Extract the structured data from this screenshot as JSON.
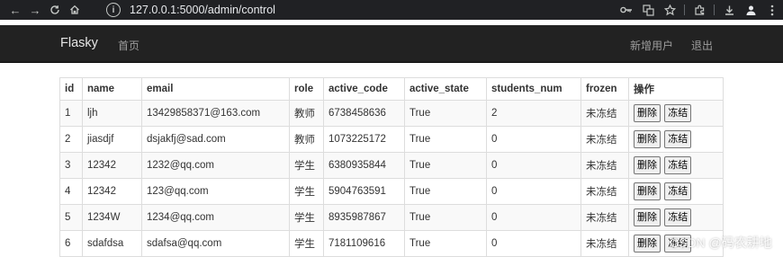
{
  "browser": {
    "url": "127.0.0.1:5000/admin/control",
    "back_glyph": "←",
    "forward_glyph": "→",
    "reload_glyph": "C",
    "home_glyph": "⌂",
    "info_glyph": "i"
  },
  "navbar": {
    "brand": "Flasky",
    "home_label": "首页",
    "add_user_label": "新增用户",
    "logout_label": "退出"
  },
  "table": {
    "headers": [
      "id",
      "name",
      "email",
      "role",
      "active_code",
      "active_state",
      "students_num",
      "frozen",
      "操作"
    ],
    "rows": [
      {
        "id": "1",
        "name": "ljh",
        "email": "13429858371@163.com",
        "role": "教师",
        "active_code": "6738458636",
        "active_state": "True",
        "students_num": "2",
        "frozen": "未冻结"
      },
      {
        "id": "2",
        "name": "jiasdjf",
        "email": "dsjakfj@sad.com",
        "role": "教师",
        "active_code": "1073225172",
        "active_state": "True",
        "students_num": "0",
        "frozen": "未冻结"
      },
      {
        "id": "3",
        "name": "12342",
        "email": "1232@qq.com",
        "role": "学生",
        "active_code": "6380935844",
        "active_state": "True",
        "students_num": "0",
        "frozen": "未冻结"
      },
      {
        "id": "4",
        "name": "12342",
        "email": "123@qq.com",
        "role": "学生",
        "active_code": "5904763591",
        "active_state": "True",
        "students_num": "0",
        "frozen": "未冻结"
      },
      {
        "id": "5",
        "name": "1234W",
        "email": "1234@qq.com",
        "role": "学生",
        "active_code": "8935987867",
        "active_state": "True",
        "students_num": "0",
        "frozen": "未冻结"
      },
      {
        "id": "6",
        "name": "sdafdsa",
        "email": "sdafsa@qq.com",
        "role": "学生",
        "active_code": "7181109616",
        "active_state": "True",
        "students_num": "0",
        "frozen": "未冻结"
      }
    ],
    "delete_label": "删除",
    "freeze_label": "冻结"
  },
  "watermark": "CSDN @码农耕地",
  "colors": {
    "navbar_bg": "#222222",
    "chrome_bg": "#202124",
    "stripe_bg": "#f9f9f9"
  }
}
